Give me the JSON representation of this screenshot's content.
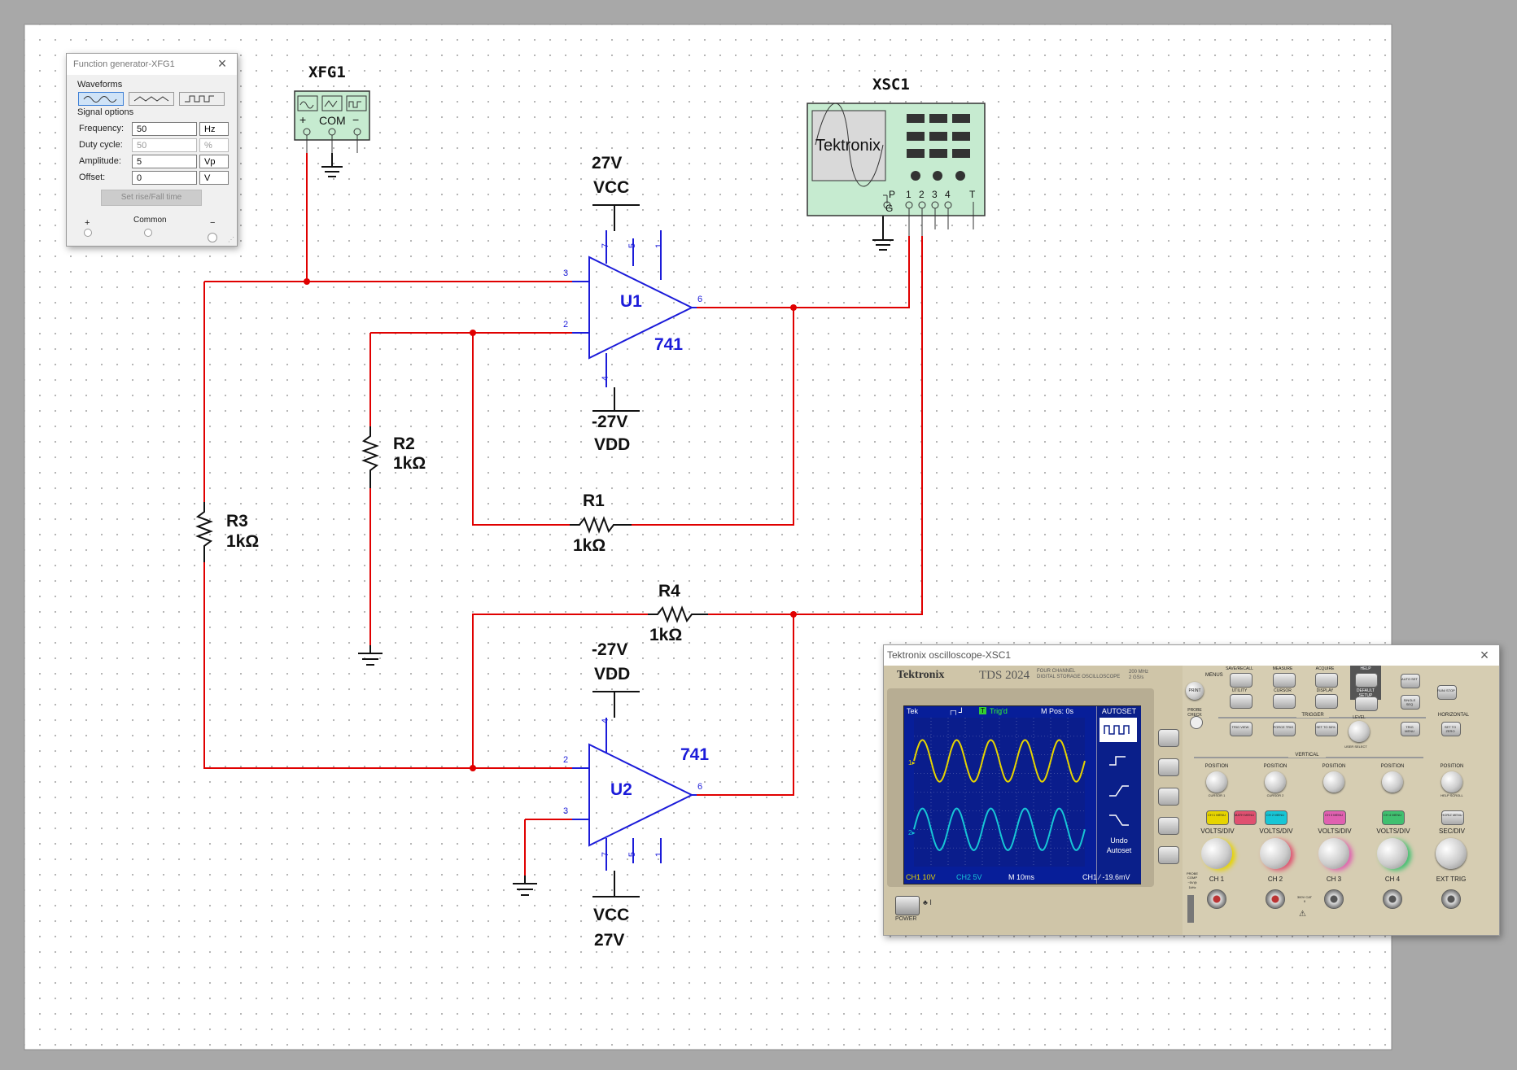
{
  "schematic": {
    "components": {
      "u1": {
        "ref": "U1",
        "model": "741",
        "pin_plus": "3",
        "pin_minus": "2",
        "pin_out": "6",
        "pin_v7": "7",
        "pin_v5": "5",
        "pin_v1": "1",
        "pin_v4": "4"
      },
      "u2": {
        "ref": "U2",
        "model": "741",
        "pin_plus": "3",
        "pin_minus": "2",
        "pin_out": "6",
        "pin_v7": "7",
        "pin_v5": "5",
        "pin_v1": "1",
        "pin_v4": "4"
      },
      "r1": {
        "ref": "R1",
        "value": "1kΩ"
      },
      "r2": {
        "ref": "R2",
        "value": "1kΩ"
      },
      "r3": {
        "ref": "R3",
        "value": "1kΩ"
      },
      "r4": {
        "ref": "R4",
        "value": "1kΩ"
      },
      "vcc_top": {
        "voltage": "27V",
        "name": "VCC"
      },
      "vdd_top": {
        "voltage": "-27V",
        "name": "VDD"
      },
      "vdd_bot": {
        "voltage": "-27V",
        "name": "VDD"
      },
      "vcc_bot": {
        "name": "VCC",
        "voltage": "27V"
      },
      "xfg1": {
        "ref": "XFG1",
        "plus": "+",
        "com": "COM",
        "minus": "−"
      },
      "xsc1": {
        "ref": "XSC1",
        "brand": "Tektronix",
        "p": "P",
        "g": "G",
        "ch1": "1",
        "ch2": "2",
        "ch3": "3",
        "ch4": "4",
        "t": "T"
      }
    }
  },
  "function_generator": {
    "title": "Function generator-XFG1",
    "close": "×",
    "waveforms_label": "Waveforms",
    "waveform_options": [
      "sine",
      "triangle",
      "square"
    ],
    "selected_waveform": "sine",
    "signal_options_label": "Signal options",
    "fields": [
      {
        "label": "Frequency:",
        "value": "50",
        "unit": "Hz",
        "enabled": true
      },
      {
        "label": "Duty cycle:",
        "value": "50",
        "unit": "%",
        "enabled": false
      },
      {
        "label": "Amplitude:",
        "value": "5",
        "unit": "Vp",
        "enabled": true
      },
      {
        "label": "Offset:",
        "value": "0",
        "unit": "V",
        "enabled": true
      }
    ],
    "rise_fall_button": "Set rise/Fall time",
    "terminal_plus": "+",
    "terminal_common": "Common",
    "terminal_minus": "−"
  },
  "oscilloscope": {
    "title": "Tektronix oscilloscope-XSC1",
    "close": "×",
    "brand": "Tektronix",
    "model": "TDS 2024",
    "model_sub1": "FOUR CHANNEL",
    "model_sub2": "DIGITAL STORAGE OSCILLOSCOPE",
    "spec1": "200 MHz",
    "spec2": "2 GS/s",
    "screen": {
      "tek": "Tek",
      "trig": "Trig'd",
      "mpos": "M Pos: 0s",
      "autoset": "AUTOSET",
      "undo": "Undo",
      "undo2": "Autoset",
      "ch1": "CH1  10V",
      "ch2": "CH2  5V",
      "mtime": "M 10ms",
      "trig_level": "CH1 ⁄ -19.6mV"
    },
    "labels": {
      "print": "PRINT",
      "probe_check": "PROBE CHECK",
      "menus": "MENUS",
      "save_recall": "SAVE/RECALL",
      "measure": "MEASURE",
      "acquire": "ACQUIRE",
      "help": "HELP",
      "autoset": "AUTO SET",
      "utility": "UTILITY",
      "cursor": "CURSOR",
      "display": "DISPLAY",
      "default_setup": "DEFAULT SETUP",
      "single_seq": "SINGLE SEQ",
      "run_stop": "RUN/ STOP",
      "trigger": "TRIGGER",
      "horizontal": "HORIZONTAL",
      "trig_view": "TRIG VIEW",
      "force_trig": "FORCE TRIG",
      "set_to_50": "SET TO 50%",
      "trig_menu": "TRIG MENU",
      "set_to_zero": "SET TO ZERO",
      "level": "LEVEL",
      "user_select": "USER SELECT",
      "vertical": "VERTICAL",
      "position": "POSITION",
      "cursor1": "CURSOR 1",
      "cursor2": "CURSOR 2",
      "help_scroll": "HELP SCROLL",
      "ch1_menu": "CH 1 MENU",
      "math_menu": "MATH MENU",
      "ch2_menu": "CH 2 MENU",
      "ch3_menu": "CH 3 MENU",
      "ch4_menu": "CH 4 MENU",
      "horiz_menu": "HORIZ MENU",
      "volts_div": "VOLTS/DIV",
      "sec_div": "SEC/DIV",
      "ch1": "CH 1",
      "ch2": "CH 2",
      "ch3": "CH 3",
      "ch4": "CH 4",
      "ext_trig": "EXT TRIG",
      "power": "POWER",
      "probe_comp": "PROBE COMP",
      "probe_comp_v": "~5V@",
      "probe_comp_f": "1kHz",
      "cat": "300V CAT II"
    },
    "traces": {
      "ch1_color": "#e6d400",
      "ch2_color": "#17c6d6",
      "cycles": 5
    }
  },
  "colors": {
    "wire": "#e00000",
    "component": "#0000dd",
    "pin_text": "#1b1bd9",
    "label": "#111111",
    "grid_dot": "#bbbbbb"
  }
}
